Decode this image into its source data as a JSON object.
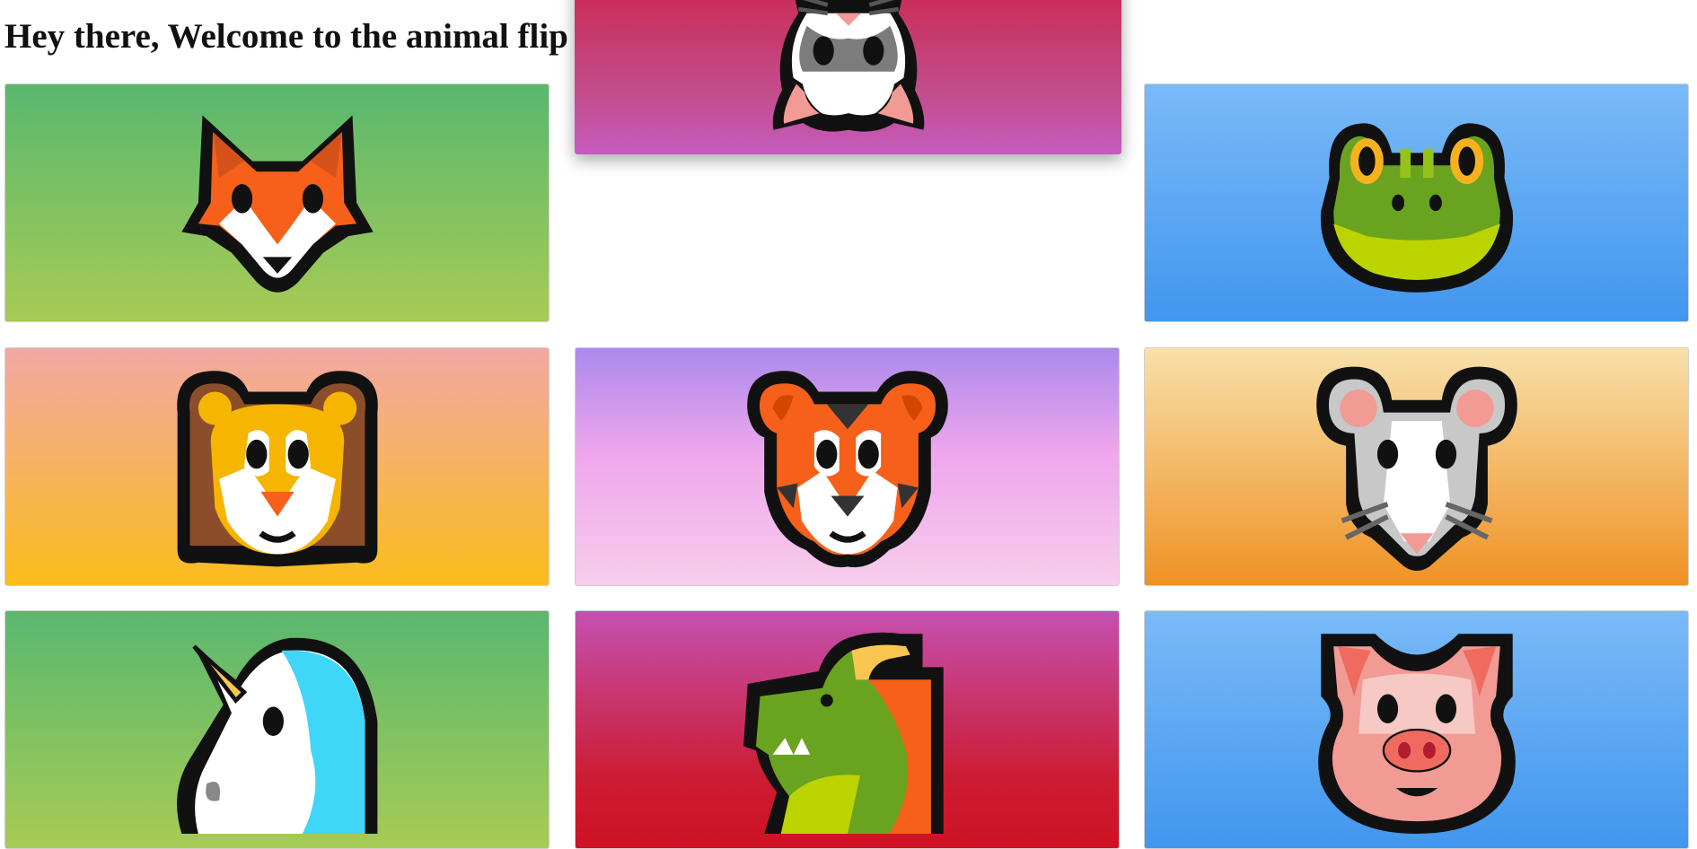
{
  "page": {
    "title": "Hey there, Welcome to the animal flip"
  },
  "cards": [
    {
      "animal": "fox-icon"
    },
    {
      "animal": "rabbit-icon",
      "state": "flipping"
    },
    {
      "animal": "frog-icon"
    },
    {
      "animal": "lion-icon"
    },
    {
      "animal": "tiger-icon"
    },
    {
      "animal": "mouse-icon"
    },
    {
      "animal": "unicorn-icon"
    },
    {
      "animal": "dragon-icon"
    },
    {
      "animal": "pig-icon"
    }
  ],
  "colors": {
    "green_gradient": [
      "#59b86f",
      "#a7cb55"
    ],
    "blue_gradient": [
      "#7abaf8",
      "#4196ee"
    ],
    "peach_gradient": [
      "#f2a8a4",
      "#fbbd1c"
    ],
    "purple_gradient": [
      "#ab89ec",
      "#f7cdec"
    ],
    "cream_gradient": [
      "#f8e0aa",
      "#ef9224"
    ],
    "magenta_gradient": [
      "#c550b0",
      "#cf1224"
    ],
    "red_gradient": [
      "#d0142a",
      "#c65bbd"
    ]
  }
}
